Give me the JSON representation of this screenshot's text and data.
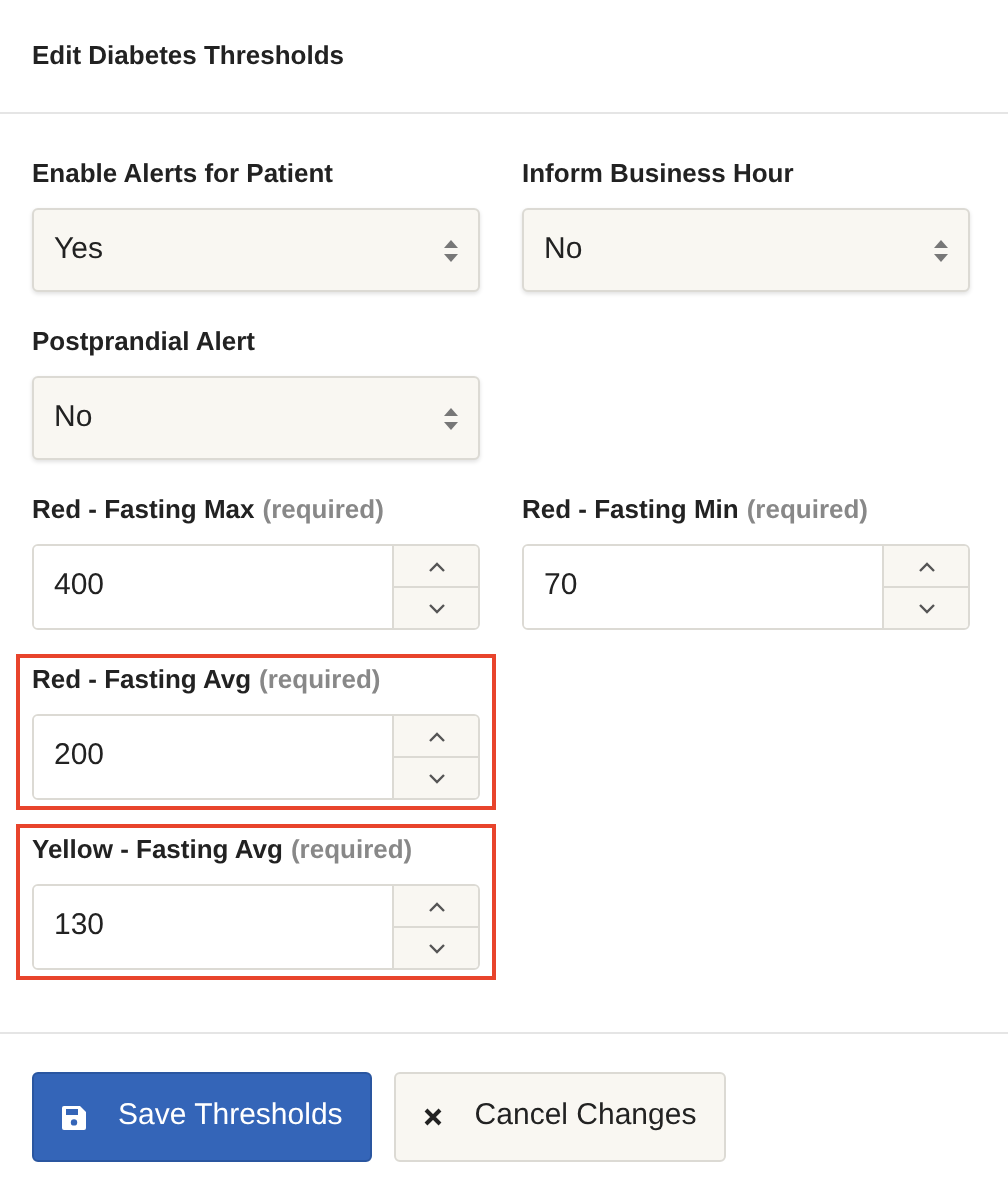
{
  "title": "Edit Diabetes Thresholds",
  "rows": [
    [
      {
        "label": "Enable Alerts for Patient",
        "kind": "select",
        "value": "Yes",
        "highlighted": false
      },
      {
        "label": "Inform Business Hour",
        "kind": "select",
        "value": "No",
        "highlighted": false
      }
    ],
    [
      {
        "label": "Postprandial Alert",
        "kind": "select",
        "value": "No",
        "highlighted": false
      }
    ],
    [
      {
        "label": "Red - Fasting Max",
        "note": "(required)",
        "kind": "number",
        "value": "400",
        "highlighted": false
      },
      {
        "label": "Red - Fasting Min",
        "note": "(required)",
        "kind": "number",
        "value": "70",
        "highlighted": false
      }
    ],
    [
      {
        "label": "Red - Fasting Avg",
        "note": "(required)",
        "kind": "number",
        "value": "200",
        "highlighted": true
      }
    ],
    [
      {
        "label": "Yellow - Fasting Avg",
        "note": "(required)",
        "kind": "number",
        "value": "130",
        "highlighted": true
      }
    ]
  ],
  "buttons": [
    {
      "label": "Save Thresholds",
      "kind": "save"
    },
    {
      "label": "Cancel Changes",
      "kind": "cancel"
    }
  ]
}
